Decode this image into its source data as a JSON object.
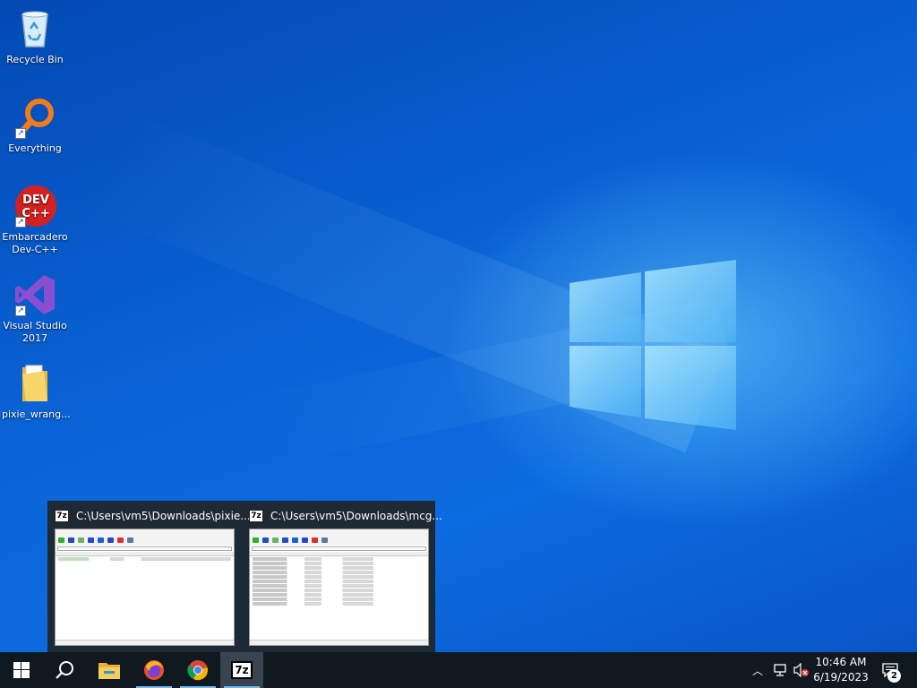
{
  "desktop": {
    "icons": [
      {
        "label": "Recycle Bin",
        "icon": "recycle-bin-icon"
      },
      {
        "label": "Everything",
        "icon": "everything-search-icon"
      },
      {
        "label": "Embarcadero Dev-C++",
        "icon": "dev-cpp-icon",
        "glyph": "DEV C++"
      },
      {
        "label": "Visual Studio 2017",
        "icon": "visual-studio-icon"
      },
      {
        "label": "pixie_wrang...",
        "icon": "folder-icon"
      }
    ]
  },
  "preview": {
    "windows": [
      {
        "title": "C:\\Users\\vm5\\Downloads\\pixie...",
        "badge": "7z"
      },
      {
        "title": "C:\\Users\\vm5\\Downloads\\mcg...",
        "badge": "7z"
      }
    ]
  },
  "taskbar": {
    "buttons": [
      "start-button",
      "search-button",
      "file-explorer-button",
      "firefox-button",
      "chrome-button",
      "7zip-button"
    ],
    "seven_zip_label": "7z",
    "clock": {
      "time": "10:46 AM",
      "date": "6/19/2023"
    },
    "notifications_count": "2"
  },
  "colors": {
    "taskbar": "#101820",
    "accent": "#76b9ed",
    "wallpaper": "#0a63d6"
  }
}
